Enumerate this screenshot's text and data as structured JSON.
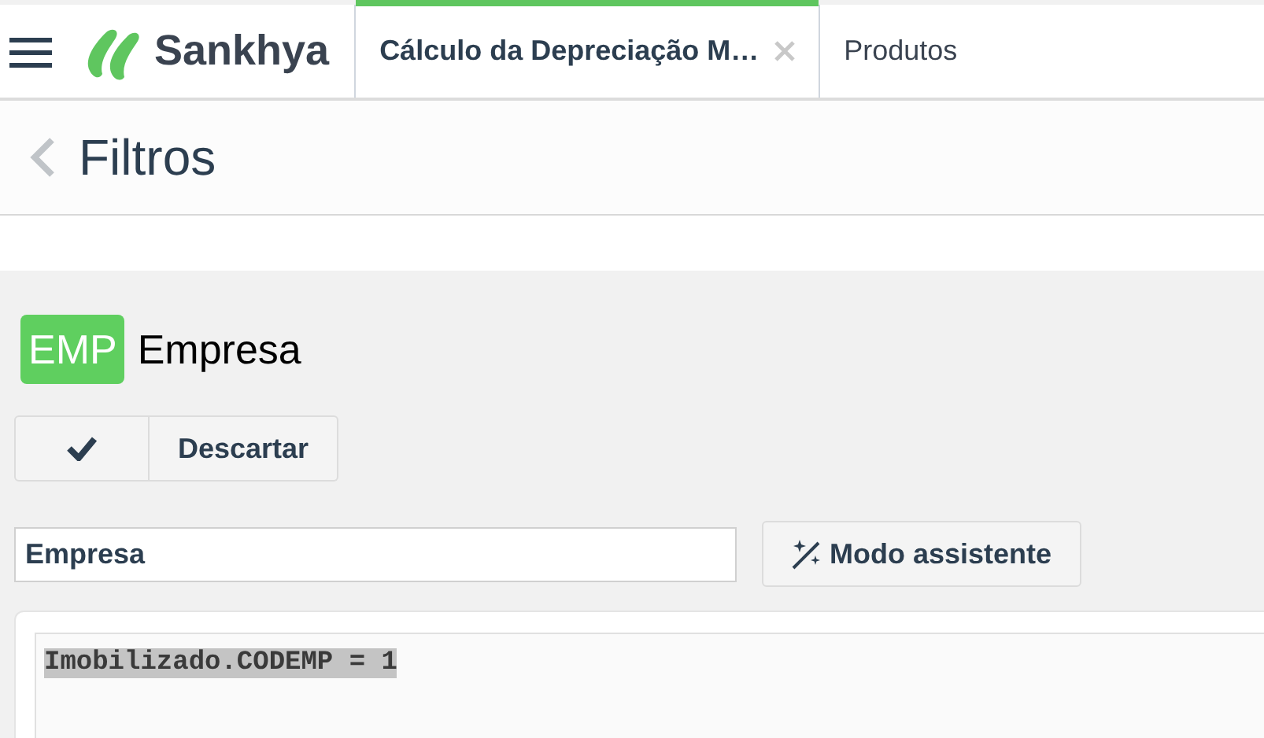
{
  "header": {
    "logo_text": "Sankhya"
  },
  "tabs": [
    {
      "label": "Cálculo da Depreciação M…",
      "selected": true,
      "closable": true
    },
    {
      "label": "Produtos",
      "selected": false,
      "closable": false
    }
  ],
  "page_title": "Filtros",
  "filter": {
    "badge": "EMP",
    "name": "Empresa",
    "discard_button": "Descartar",
    "name_field": {
      "value": "Empresa"
    },
    "assistant_button": "Modo assistente",
    "expression": "Imobilizado.CODEMP = 1"
  }
}
